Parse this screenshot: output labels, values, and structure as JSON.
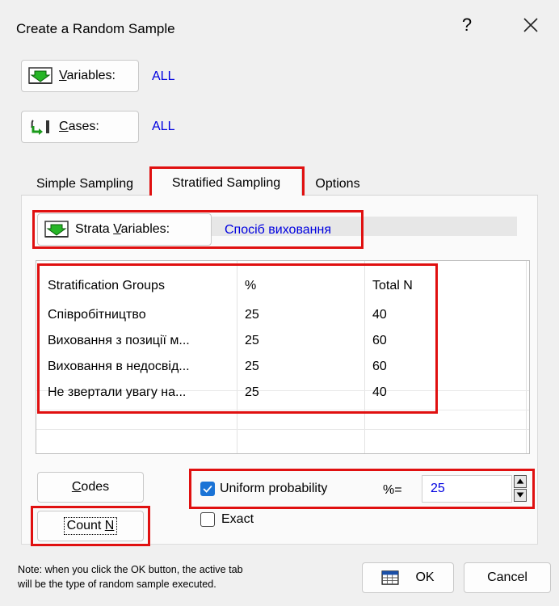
{
  "window": {
    "title": "Create a Random Sample",
    "help": "?"
  },
  "variables": {
    "button_prefix": "",
    "button_underline": "V",
    "button_rest": "ariables:",
    "value": "ALL"
  },
  "cases": {
    "button_underline": "C",
    "button_rest": "ases:",
    "value": "ALL"
  },
  "tabs": [
    {
      "label": "Simple Sampling"
    },
    {
      "label": "Stratified Sampling"
    },
    {
      "label": "Options"
    }
  ],
  "strata": {
    "button_pre": "Strata ",
    "button_underline": "V",
    "button_rest": "ariables:",
    "value": "Спосіб виховання"
  },
  "table": {
    "headers": [
      "Stratification Groups",
      "%",
      "Total N"
    ],
    "rows": [
      {
        "group": "Співробітництво",
        "pct": "25",
        "total": "40"
      },
      {
        "group": "Виховання з позиції м...",
        "pct": "25",
        "total": "60"
      },
      {
        "group": "Виховання в недосвід...",
        "pct": "25",
        "total": "60"
      },
      {
        "group": "Не звертали увагу на...",
        "pct": "25",
        "total": "40"
      }
    ]
  },
  "codes": {
    "underline": "C",
    "rest": "odes"
  },
  "count_n": {
    "pre": "Count ",
    "underline": "N"
  },
  "uniform": {
    "label": "Uniform probability",
    "checked": true,
    "pct_label": "%=",
    "value": "25"
  },
  "exact": {
    "label": "Exact",
    "checked": false
  },
  "note": {
    "line1": "Note: when you click the OK button, the active tab",
    "line2": "will be the type of random sample executed."
  },
  "ok_label": "OK",
  "cancel_label": "Cancel",
  "colors": {
    "highlight": "#e01010",
    "link": "#0000e0",
    "checkbox": "#1a73d6"
  }
}
